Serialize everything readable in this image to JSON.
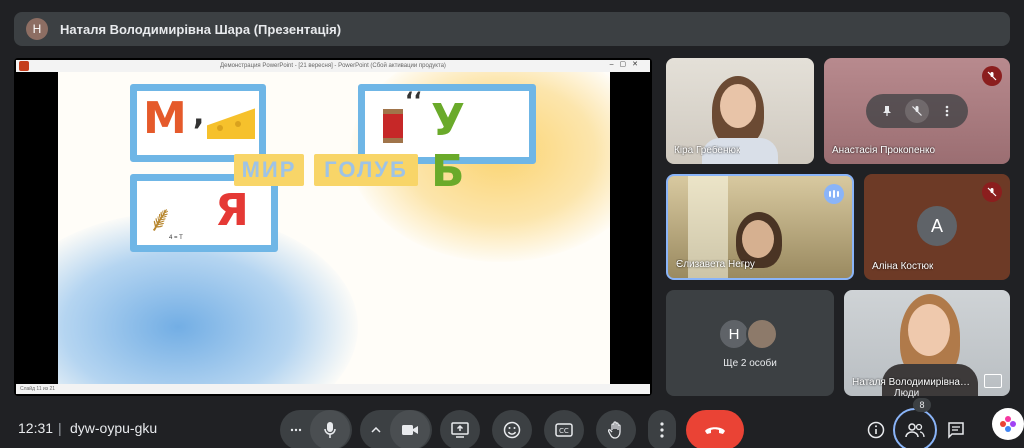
{
  "presenter": {
    "avatar_initial": "Н",
    "title": "Наталя Володимирівна Шара (Презентація)"
  },
  "shared_screen": {
    "window_title": "Демонстрация PowerPoint - [21 вересня] - PowerPoint (Сбой активации продукта)",
    "status_text": "Слайд 11 из 21",
    "slide": {
      "card1_letter": "М",
      "card1_comma": ",",
      "card2_letters": "У Б",
      "card2_marks": "‘‘",
      "card3_letter": "Я",
      "card3_note": "4 = Т",
      "word1": "МИР",
      "word2": "ГОЛУБ"
    }
  },
  "participants": [
    {
      "name": "Кіра Гребенюк"
    },
    {
      "name": "Анастасія Прокопенко"
    },
    {
      "name": "Єлизавета Негру"
    },
    {
      "name": "Аліна Костюк",
      "initial": "А"
    },
    {
      "name": "Ще 2 особи",
      "initial": "Н"
    },
    {
      "name": "Наталя Володимирівна Шара"
    }
  ],
  "bottom_bar": {
    "time": "12:31",
    "separator": "|",
    "meeting_code": "dyw-oypu-gku",
    "people_tooltip": "Люди",
    "people_count": "8"
  },
  "colors": {
    "background": "#202124",
    "surface": "#3c4043",
    "end_call": "#ea4335",
    "accent": "#8ab4f8",
    "muted": "#8b1e1e"
  }
}
